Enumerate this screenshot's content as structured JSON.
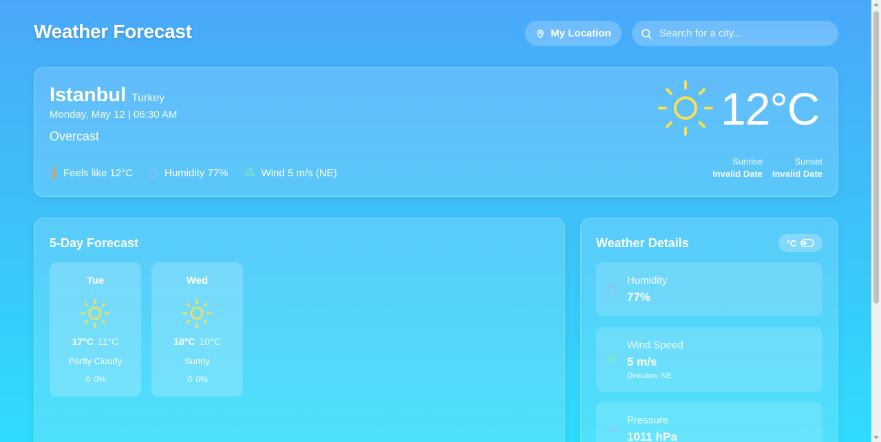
{
  "header": {
    "title": "Weather Forecast",
    "location_button": "My Location",
    "search_placeholder": "Search for a city..."
  },
  "current": {
    "city": "Istanbul",
    "country": "Turkey",
    "datetime": "Monday, May 12 | 06:30 AM",
    "condition": "Overcast",
    "temperature": "12°C",
    "icon": "sun-icon",
    "feels_like": "Feels like 12°C",
    "humidity": "Humidity 77%",
    "wind": "Wind 5 m/s (NE)",
    "sunrise_label": "Sunrise",
    "sunrise_value": "Invalid Date",
    "sunset_label": "Sunset",
    "sunset_value": "Invalid Date"
  },
  "forecast": {
    "title": "5-Day Forecast",
    "days": [
      {
        "day": "Tue",
        "high": "17°C",
        "low": "11°C",
        "condition": "Partly Cloudy",
        "rain": "0%",
        "icon": "sun-icon"
      },
      {
        "day": "Wed",
        "high": "18°C",
        "low": "10°C",
        "condition": "Sunny",
        "rain": "0%",
        "icon": "sun-icon"
      }
    ]
  },
  "details": {
    "title": "Weather Details",
    "unit_label": "°C",
    "items": [
      {
        "label": "Humidity",
        "value": "77%",
        "icon": "droplet-icon"
      },
      {
        "label": "Wind Speed",
        "value": "5 m/s",
        "sub": "Direction: NE",
        "icon": "wind-icon"
      },
      {
        "label": "Pressure",
        "value": "1011 hPa",
        "icon": "gauge-icon"
      }
    ]
  },
  "colors": {
    "sun": "#fde047",
    "thermometer": "#fb923c",
    "humidity": "#a5b4fc",
    "wind": "#86efac"
  }
}
